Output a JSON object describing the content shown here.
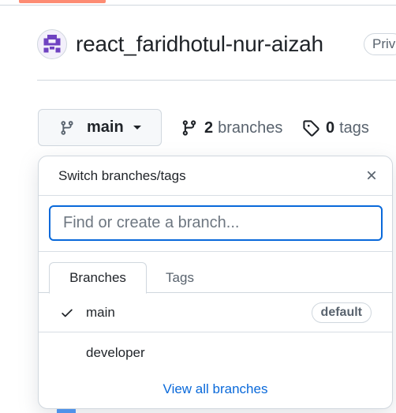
{
  "repo": {
    "name": "react_faridhotul-nur-aizah",
    "visibility": "Priv"
  },
  "branch_selector": {
    "current": "main"
  },
  "meta": {
    "branches_count": "2",
    "branches_label": "branches",
    "tags_count": "0",
    "tags_label": "tags"
  },
  "dropdown": {
    "title": "Switch branches/tags",
    "filter_placeholder": "Find or create a branch...",
    "tabs": [
      "Branches",
      "Tags"
    ],
    "branches": [
      {
        "name": "main",
        "badge": "default",
        "selected": true
      },
      {
        "name": "developer"
      }
    ],
    "footer_link": "View all branches"
  },
  "colors": {
    "accent": "#0969da",
    "tab_underline": "#fd8c73",
    "avatar": "#6f42c1"
  },
  "icons": {
    "branch": "git-branch-icon",
    "tag": "tag-icon",
    "close": "x-icon",
    "check": "check-icon"
  }
}
